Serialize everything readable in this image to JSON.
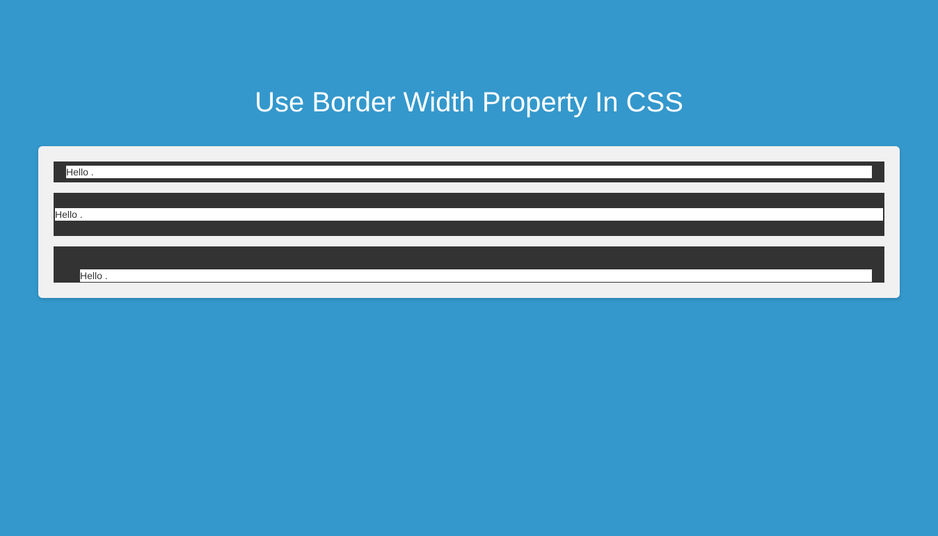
{
  "title": "Use Border Width Property In CSS",
  "boxes": {
    "box1": "Hello .",
    "box2": "Hello .",
    "box3": "Hello ."
  }
}
